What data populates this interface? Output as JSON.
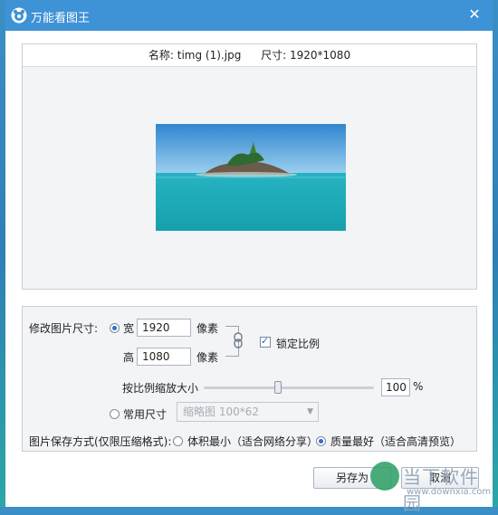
{
  "window": {
    "title": "万能看图王",
    "close_glyph": "✕"
  },
  "preview": {
    "name_label": "名称: timg (1).jpg",
    "size_label": "尺寸: 1920*1080"
  },
  "resize": {
    "section_label": "修改图片尺寸:",
    "width_label": "宽",
    "width_value": "1920",
    "width_unit": "像素",
    "height_label": "高",
    "height_value": "1080",
    "height_unit": "像素",
    "lock_ratio_label": "锁定比例",
    "lock_ratio_checked": true,
    "link_icon": "chain-link-icon",
    "scale_label": "按比例缩放大小",
    "scale_value": "100",
    "scale_unit": "%",
    "scale_level": 1.0,
    "common_size_label": "常用尺寸",
    "common_size_selected": "缩略图 100*62"
  },
  "save_mode": {
    "section_label": "图片保存方式(仅限压缩格式):",
    "options": [
      {
        "label": "体积最小（适合网络分享）",
        "checked": false
      },
      {
        "label": "质量最好（适合高清预览）",
        "checked": true
      }
    ]
  },
  "buttons": {
    "save_as": "另存为",
    "cancel": "取消"
  },
  "watermark": {
    "text": "当下软件园",
    "url": "www.downxia.com"
  },
  "colors": {
    "titlebar": "#3e92d6",
    "accent": "#2b6fcf"
  }
}
